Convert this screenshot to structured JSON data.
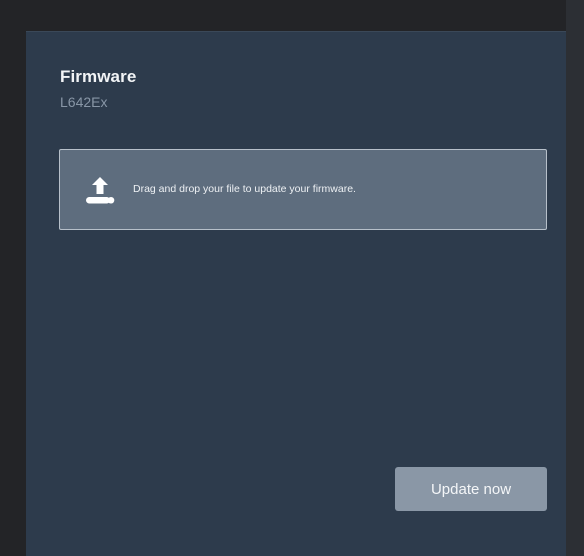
{
  "firmware": {
    "title": "Firmware",
    "model": "L642Ex"
  },
  "dropzone": {
    "icon": "upload-icon",
    "message": "Drag and drop your file to update your firmware."
  },
  "actions": {
    "update_label": "Update now"
  },
  "colors": {
    "panel_background": "#2d3b4c",
    "dropzone_background": "#5e6d7e",
    "dropzone_border": "#b7c0ca",
    "button_background": "#8a97a6"
  }
}
